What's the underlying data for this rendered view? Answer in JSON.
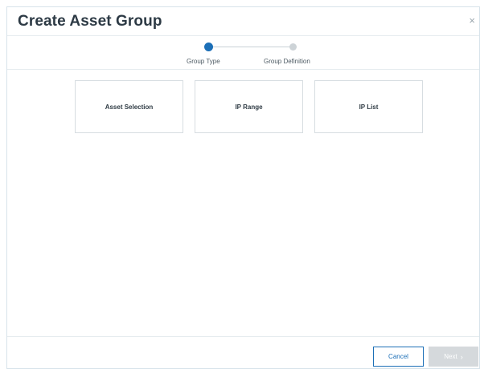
{
  "dialog": {
    "title": "Create Asset Group",
    "close_glyph": "×"
  },
  "stepper": {
    "steps": [
      {
        "label": "Group Type",
        "state": "active"
      },
      {
        "label": "Group Definition",
        "state": "inactive"
      }
    ]
  },
  "options": [
    {
      "label": "Asset Selection"
    },
    {
      "label": "IP Range"
    },
    {
      "label": "IP List"
    }
  ],
  "footer": {
    "cancel_label": "Cancel",
    "next_label": "Next",
    "next_glyph": "›"
  },
  "colors": {
    "accent": "#1c6fb7",
    "disabled": "#d5d9dc"
  }
}
